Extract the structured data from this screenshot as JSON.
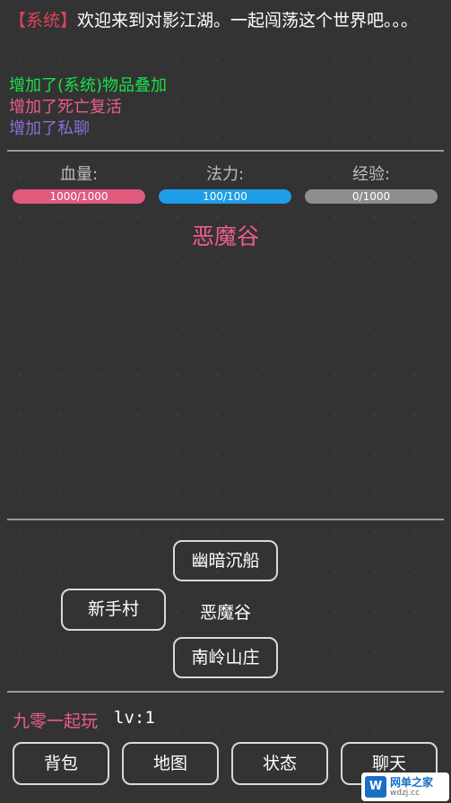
{
  "log": {
    "system_tag": "【系统】",
    "welcome": "欢迎来到对影江湖。一起闯荡这个世界吧。。。",
    "lines": [
      {
        "text": "增加了(系统)物品叠加",
        "color": "#19e04a"
      },
      {
        "text": "增加了死亡复活",
        "color": "#ee5d88"
      },
      {
        "text": "增加了私聊",
        "color": "#8a6fd8"
      }
    ]
  },
  "stats": {
    "hp": {
      "label": "血量:",
      "text": "1000/1000",
      "fraction": 1.0,
      "color": "#e05a7e"
    },
    "mp": {
      "label": "法力:",
      "text": "100/100",
      "fraction": 1.0,
      "color": "#1e9de8"
    },
    "exp": {
      "label": "经验:",
      "text": "0/1000",
      "fraction": 0.0,
      "color": "#8e8e8e"
    }
  },
  "area": {
    "title": "恶魔谷"
  },
  "map": {
    "north": "幽暗沉船",
    "west": "新手村",
    "current": "恶魔谷",
    "south": "南岭山庄"
  },
  "player": {
    "name": "九零一起玩",
    "level": "lv:1"
  },
  "menu": {
    "bag": "背包",
    "map": "地图",
    "status": "状态",
    "chat": "聊天"
  },
  "watermark": {
    "logo_t1": "网单之家",
    "logo_t2": "wdzj.cc",
    "mark": "W"
  }
}
